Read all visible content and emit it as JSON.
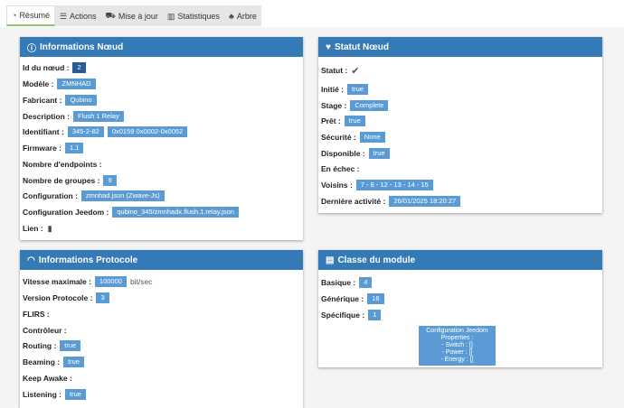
{
  "tabs": [
    {
      "label": "Résumé",
      "icon": "dashboard-icon"
    },
    {
      "label": "Actions",
      "icon": "list-icon"
    },
    {
      "label": "Mise à jour",
      "icon": "car-icon"
    },
    {
      "label": "Statistiques",
      "icon": "chart-icon"
    },
    {
      "label": "Arbre",
      "icon": "tree-icon"
    }
  ],
  "node_info": {
    "title": "Informations Nœud",
    "rows": [
      {
        "label": "Id du nœud :",
        "values": [
          "2"
        ],
        "dark": true
      },
      {
        "label": "Modèle :",
        "values": [
          "ZMNHAD"
        ]
      },
      {
        "label": "Fabricant :",
        "values": [
          "Qubino"
        ]
      },
      {
        "label": "Description :",
        "values": [
          "Flush 1 Relay"
        ]
      },
      {
        "label": "Identifiant :",
        "values": [
          "345-2-82",
          "0x0159 0x0002-0x0052"
        ]
      },
      {
        "label": "Firmware :",
        "values": [
          "1.1"
        ]
      },
      {
        "label": "Nombre d'endpoints :",
        "values": []
      },
      {
        "label": "Nombre de groupes :",
        "values": [
          "9"
        ]
      },
      {
        "label": "Configuration :",
        "values": [
          "zmnhad.json (Zwave-Js)"
        ]
      },
      {
        "label": "Configuration Jeedom :",
        "values": [
          "qubino_345/zmnhadx.flush.1.relay.json"
        ]
      },
      {
        "label": "Lien :",
        "values": [],
        "icon": "book-icon"
      }
    ]
  },
  "node_status": {
    "title": "Statut Nœud",
    "rows": [
      {
        "label": "Statut :",
        "values": [],
        "icon": "check-icon"
      },
      {
        "label": "Initié :",
        "values": [
          "true"
        ]
      },
      {
        "label": "Stage :",
        "values": [
          "Complete"
        ]
      },
      {
        "label": "Prêt :",
        "values": [
          "true"
        ]
      },
      {
        "label": "Sécurité :",
        "values": [
          "None"
        ]
      },
      {
        "label": "Disponible :",
        "values": [
          "true"
        ]
      },
      {
        "label": "En échec :",
        "values": []
      },
      {
        "label": "Voisins :",
        "values": [
          "7 - 8 - 12 - 13 - 14 - 15"
        ]
      },
      {
        "label": "Dernière activité :",
        "values": [
          "26/01/2025 18:20:27"
        ]
      }
    ]
  },
  "protocol_info": {
    "title": "Informations Protocole",
    "rows": [
      {
        "label": "Vitesse maximale :",
        "values": [
          "100000"
        ],
        "unit": "bit/sec"
      },
      {
        "label": "Version Protocole :",
        "values": [
          "3"
        ]
      },
      {
        "label": "FLIRS :",
        "values": []
      },
      {
        "label": "Contrôleur :",
        "values": []
      },
      {
        "label": "Routing :",
        "values": [
          "true"
        ]
      },
      {
        "label": "Beaming :",
        "values": [
          "true"
        ]
      },
      {
        "label": "Keep Awake :",
        "values": []
      },
      {
        "label": "Listening :",
        "values": [
          "true"
        ]
      }
    ]
  },
  "module_class": {
    "title": "Classe du module",
    "rows": [
      {
        "label": "Basique :",
        "values": [
          "4"
        ]
      },
      {
        "label": "Générique :",
        "values": [
          "16"
        ]
      },
      {
        "label": "Spécifique :",
        "values": [
          "1"
        ]
      }
    ],
    "config_box": [
      "Configuration Jeedom",
      "Properties :",
      "- Switch : []",
      "- Power : []",
      "- Energy : []"
    ]
  }
}
